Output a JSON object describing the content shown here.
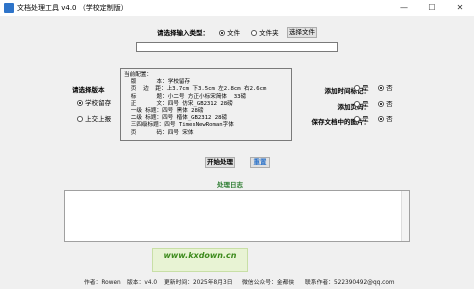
{
  "window": {
    "title": "文档处理工具 v4.0  （学校定制版）",
    "minimize": "—",
    "maximize": "☐",
    "close": "✕"
  },
  "input_type": {
    "label": "请选择输入类型：",
    "options": [
      {
        "label": "文件",
        "selected": true
      },
      {
        "label": "文件夹",
        "selected": false
      }
    ],
    "select_button": "选择文件",
    "path_value": ""
  },
  "version": {
    "label": "请选择版本",
    "options": [
      {
        "label": "学校留存",
        "selected": true
      },
      {
        "label": "上交上报",
        "selected": false
      }
    ]
  },
  "config": {
    "heading": "当前配置：",
    "lines": [
      "  版      本：学校留存",
      "  页  边  距：上3.7cm 下3.5cm 左2.8cm 右2.6cm",
      "  标      题：小二号 方正小标宋简体  33磅",
      "  正      文：四号 仿宋_GB2312 28磅",
      "  一级 标题：四号 黑体 28磅",
      "  二级 标题：四号 楷体_GB2312 28磅",
      "  三四级标题：四号 TimesNewRoman字体",
      "  页      码：四号 宋体"
    ]
  },
  "options": [
    {
      "label": "添加时间标记：",
      "choices": [
        {
          "label": "是",
          "selected": false
        },
        {
          "label": "否",
          "selected": true
        }
      ]
    },
    {
      "label": "添加页码：",
      "choices": [
        {
          "label": "是",
          "selected": false
        },
        {
          "label": "否",
          "selected": true
        }
      ]
    },
    {
      "label": "保存文档中的图片：",
      "choices": [
        {
          "label": "是",
          "selected": false
        },
        {
          "label": "否",
          "selected": true
        }
      ]
    }
  ],
  "actions": {
    "start": "开始处理",
    "reset": "重置"
  },
  "log": {
    "title": "处理日志",
    "content": ""
  },
  "watermark": {
    "text": "www.kxdown.cn"
  },
  "footer": {
    "author": "作者：Rowen",
    "version": "版本：v4.0",
    "date": "更新时间：2025年8月3日",
    "wechat": "微信公众号：金都侠",
    "contact": "联系作者：522390492@qq.com"
  },
  "colors": {
    "log_title": "#2e7d32",
    "accent": "#2e74c9"
  }
}
